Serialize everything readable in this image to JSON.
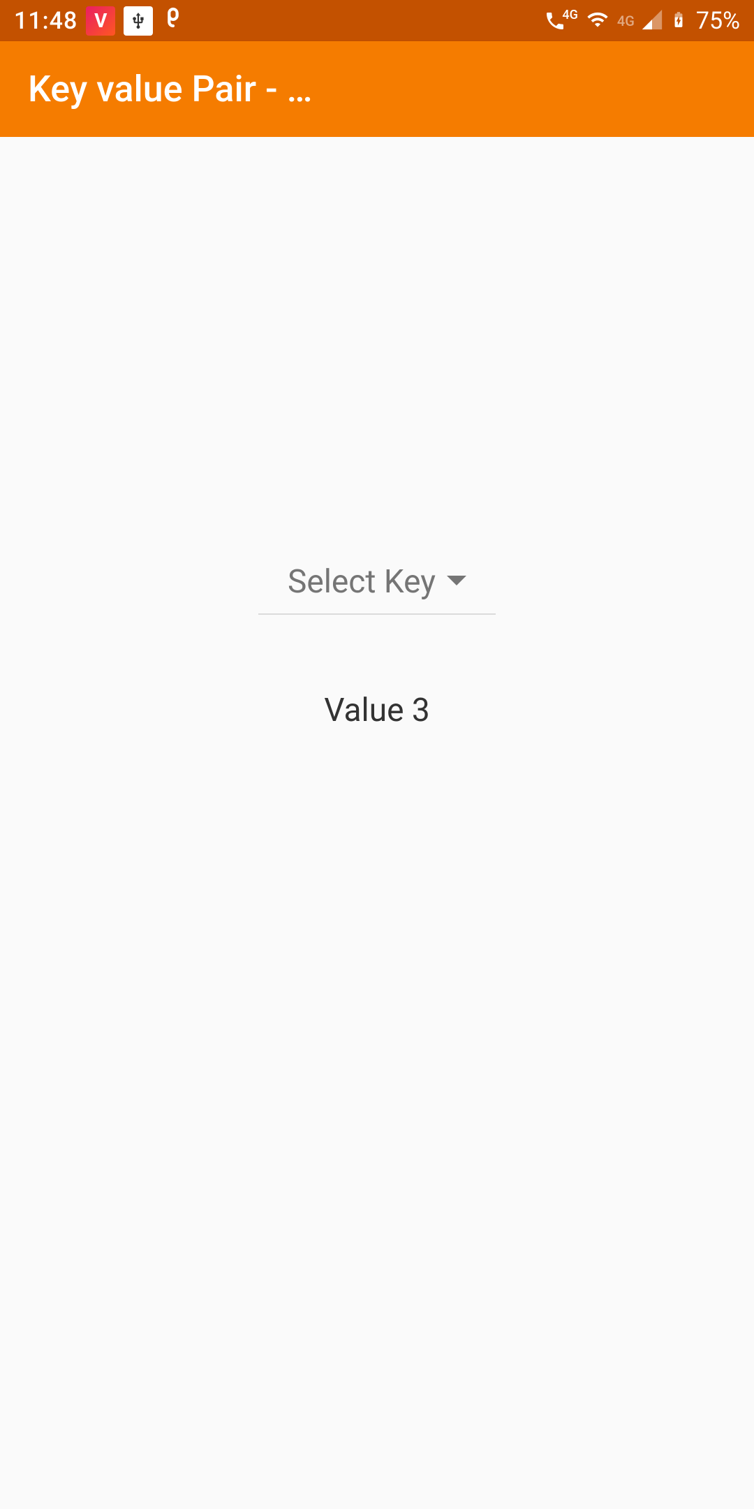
{
  "status_bar": {
    "time": "11:48",
    "battery_pct": "75%",
    "network_label_1": "4G",
    "network_label_2": "4G"
  },
  "app_bar": {
    "title": "Key value Pair - …"
  },
  "main": {
    "spinner_label": "Select Key",
    "value_text": "Value 3"
  }
}
